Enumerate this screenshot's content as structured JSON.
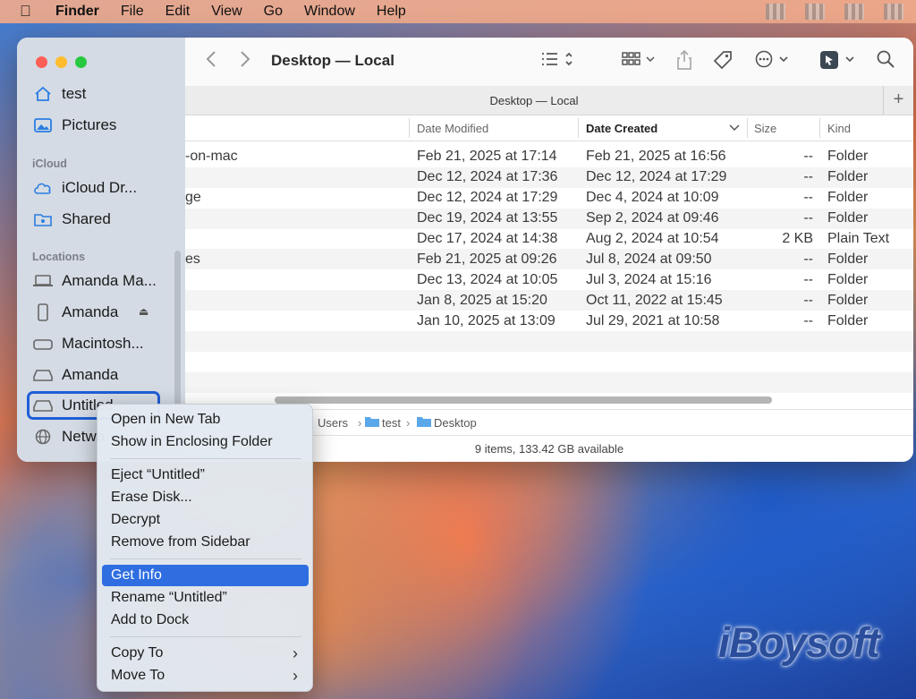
{
  "menubar": {
    "app": "Finder",
    "items": [
      "File",
      "Edit",
      "View",
      "Go",
      "Window",
      "Help"
    ]
  },
  "sidebar": {
    "favorites": [
      {
        "label": "test",
        "icon": "home-icon"
      },
      {
        "label": "Pictures",
        "icon": "pictures-icon"
      }
    ],
    "icloud_header": "iCloud",
    "icloud": [
      {
        "label": "iCloud Dr...",
        "icon": "cloud-icon"
      },
      {
        "label": "Shared",
        "icon": "shared-folder-icon"
      }
    ],
    "locations_header": "Locations",
    "locations": [
      {
        "label": "Amanda Ma...",
        "icon": "laptop-icon"
      },
      {
        "label": "Amanda",
        "icon": "phone-icon"
      },
      {
        "label": "Macintosh...",
        "icon": "disk-icon"
      },
      {
        "label": "Amanda",
        "icon": "external-disk-icon"
      },
      {
        "label": "Untitled",
        "icon": "external-disk-icon"
      },
      {
        "label": "Netwo",
        "icon": "network-icon"
      }
    ]
  },
  "toolbar": {
    "title": "Desktop — Local"
  },
  "tab": {
    "title": "Desktop — Local"
  },
  "columns": {
    "modified": "Date Modified",
    "created": "Date Created",
    "size": "Size",
    "kind": "Kind"
  },
  "rows": [
    {
      "name": "-on-mac",
      "modified": "Feb 21, 2025 at 17:14",
      "created": "Feb 21, 2025 at 16:56",
      "size": "--",
      "kind": "Folder"
    },
    {
      "name": "",
      "modified": "Dec 12, 2024 at 17:36",
      "created": "Dec 12, 2024 at 17:29",
      "size": "--",
      "kind": "Folder"
    },
    {
      "name": "ge",
      "modified": "Dec 12, 2024 at 17:29",
      "created": "Dec 4, 2024 at 10:09",
      "size": "--",
      "kind": "Folder"
    },
    {
      "name": "",
      "modified": "Dec 19, 2024 at 13:55",
      "created": "Sep 2, 2024 at 09:46",
      "size": "--",
      "kind": "Folder"
    },
    {
      "name": "",
      "modified": "Dec 17, 2024 at 14:38",
      "created": "Aug 2, 2024 at 10:54",
      "size": "2 KB",
      "kind": "Plain Text"
    },
    {
      "name": "es",
      "modified": "Feb 21, 2025 at 09:26",
      "created": "Jul 8, 2024 at 09:50",
      "size": "--",
      "kind": "Folder"
    },
    {
      "name": "",
      "modified": "Dec 13, 2024 at 10:05",
      "created": "Jul 3, 2024 at 15:16",
      "size": "--",
      "kind": "Folder"
    },
    {
      "name": "",
      "modified": "Jan 8, 2025 at 15:20",
      "created": "Oct 11, 2022 at 15:45",
      "size": "--",
      "kind": "Folder"
    },
    {
      "name": "",
      "modified": "Jan 10, 2025 at 13:09",
      "created": "Jul 29, 2021 at 10:58",
      "size": "--",
      "kind": "Folder"
    }
  ],
  "path": [
    "Users",
    "test",
    "Desktop"
  ],
  "status": "9 items, 133.42 GB available",
  "context_menu": {
    "open_new_tab": "Open in New Tab",
    "show_enclosing": "Show in Enclosing Folder",
    "eject": "Eject “Untitled”",
    "erase": "Erase Disk...",
    "decrypt": "Decrypt",
    "remove_sidebar": "Remove from Sidebar",
    "get_info": "Get Info",
    "rename": "Rename “Untitled”",
    "add_dock": "Add to Dock",
    "copy_to": "Copy To",
    "move_to": "Move To"
  },
  "watermark": "iBoysoft",
  "colors": {
    "accent": "#2f6ee0",
    "selection_border": "#1f5fd6"
  }
}
